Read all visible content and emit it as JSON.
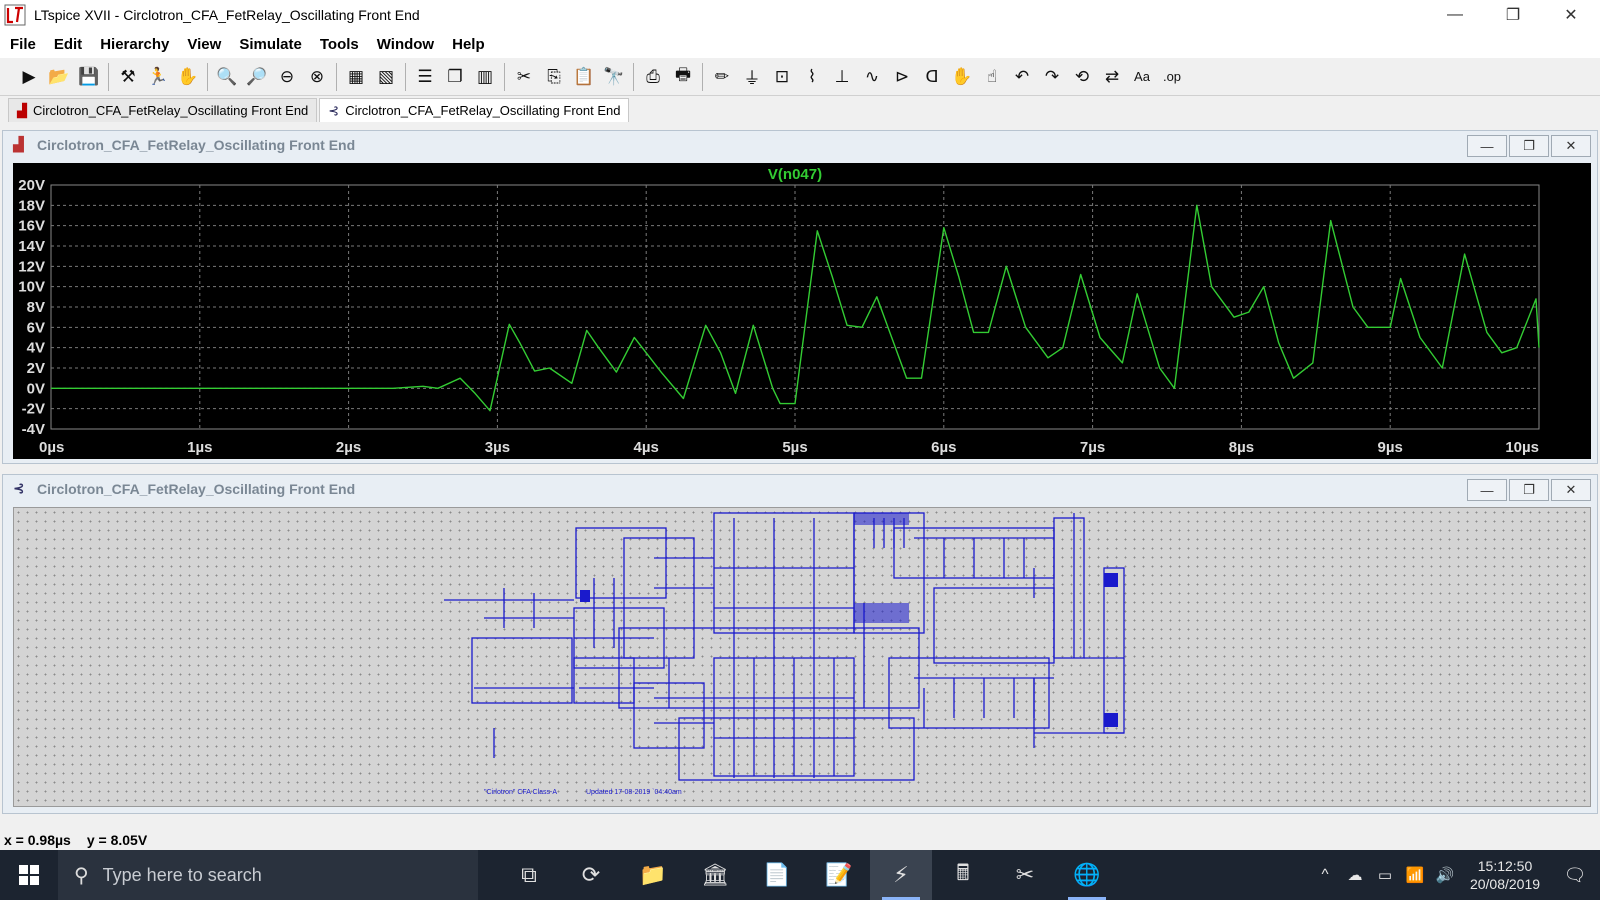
{
  "window": {
    "title": "LTspice XVII - Circlotron_CFA_FetRelay_Oscillating Front End"
  },
  "menu": [
    "File",
    "Edit",
    "Hierarchy",
    "View",
    "Simulate",
    "Tools",
    "Window",
    "Help"
  ],
  "toolbar": {
    "buttons": [
      {
        "name": "run-icon",
        "glyph": "▶"
      },
      {
        "name": "open-icon",
        "glyph": "📂"
      },
      {
        "name": "save-icon",
        "glyph": "💾"
      },
      {
        "sep": true
      },
      {
        "name": "control-panel-icon",
        "glyph": "⚒"
      },
      {
        "name": "run-sim-icon",
        "glyph": "🏃"
      },
      {
        "name": "halt-icon",
        "glyph": "✋"
      },
      {
        "sep": true
      },
      {
        "name": "zoom-in-icon",
        "glyph": "🔍"
      },
      {
        "name": "zoom-pan-icon",
        "glyph": "🔎"
      },
      {
        "name": "zoom-out-icon",
        "glyph": "⊖"
      },
      {
        "name": "zoom-fit-icon",
        "glyph": "⊗"
      },
      {
        "sep": true
      },
      {
        "name": "autorange-icon",
        "glyph": "▦"
      },
      {
        "name": "delete-trace-icon",
        "glyph": "▧"
      },
      {
        "sep": true
      },
      {
        "name": "tile-horizontal-icon",
        "glyph": "☰"
      },
      {
        "name": "cascade-icon",
        "glyph": "❐"
      },
      {
        "name": "tile-vertical-icon",
        "glyph": "▥"
      },
      {
        "sep": true
      },
      {
        "name": "cut-icon",
        "glyph": "✂"
      },
      {
        "name": "copy-icon",
        "glyph": "⎘"
      },
      {
        "name": "paste-icon",
        "glyph": "📋"
      },
      {
        "name": "find-icon",
        "glyph": "🔭"
      },
      {
        "sep": true
      },
      {
        "name": "print-icon",
        "glyph": "⎙"
      },
      {
        "name": "print-setup-icon",
        "glyph": "🖶"
      },
      {
        "sep": true
      },
      {
        "name": "wire-icon",
        "glyph": "✏"
      },
      {
        "name": "ground-icon",
        "glyph": "⏚"
      },
      {
        "name": "label-net-icon",
        "glyph": "⊡"
      },
      {
        "name": "resistor-icon",
        "glyph": "⌇"
      },
      {
        "name": "capacitor-icon",
        "glyph": "⊥"
      },
      {
        "name": "inductor-icon",
        "glyph": "∿"
      },
      {
        "name": "diode-icon",
        "glyph": "⊳"
      },
      {
        "name": "component-icon",
        "glyph": "ᗡ"
      },
      {
        "name": "move-icon",
        "glyph": "✋"
      },
      {
        "name": "drag-icon",
        "glyph": "☝"
      },
      {
        "name": "undo-icon",
        "glyph": "↶"
      },
      {
        "name": "redo-icon",
        "glyph": "↷"
      },
      {
        "name": "rotate-icon",
        "glyph": "⟲"
      },
      {
        "name": "mirror-icon",
        "glyph": "⇄"
      },
      {
        "name": "text-icon",
        "glyph": "Aa"
      },
      {
        "name": "spice-directive-icon",
        "glyph": ".op"
      }
    ]
  },
  "tabs": [
    {
      "label": "Circlotron_CFA_FetRelay_Oscillating Front End",
      "icon": "waveform-icon",
      "active": false
    },
    {
      "label": "Circlotron_CFA_FetRelay_Oscillating Front End",
      "icon": "schematic-icon",
      "active": true
    }
  ],
  "plot_window": {
    "title": "Circlotron_CFA_FetRelay_Oscillating Front End",
    "minimize": "—",
    "restore": "❐",
    "close": "✕"
  },
  "schematic_window": {
    "title": "Circlotron_CFA_FetRelay_Oscillating Front End",
    "minimize": "—",
    "restore": "❐",
    "close": "✕",
    "caption_left": "\"Cirlotron\" CFA Class-A",
    "caption_right": "Updated 17-08-2019  `04:40am"
  },
  "chart_data": {
    "type": "line",
    "title": "V(n047)",
    "xlabel": "",
    "ylabel": "",
    "xlim": [
      0,
      10
    ],
    "ylim": [
      -4,
      20
    ],
    "x_ticks": [
      "0µs",
      "1µs",
      "2µs",
      "3µs",
      "4µs",
      "5µs",
      "6µs",
      "7µs",
      "8µs",
      "9µs",
      "10µs"
    ],
    "y_ticks": [
      "20V",
      "18V",
      "16V",
      "14V",
      "12V",
      "10V",
      "8V",
      "6V",
      "4V",
      "2V",
      "0V",
      "-2V",
      "-4V"
    ],
    "grid": true,
    "trace_color": "#33cc33",
    "series": [
      {
        "name": "V(n047)",
        "x": [
          0,
          1,
          2,
          2.3,
          2.5,
          2.6,
          2.75,
          2.85,
          2.95,
          3.08,
          3.15,
          3.25,
          3.35,
          3.5,
          3.6,
          3.68,
          3.8,
          3.92,
          4.0,
          4.1,
          4.25,
          4.4,
          4.5,
          4.6,
          4.72,
          4.85,
          4.9,
          5.0,
          5.15,
          5.25,
          5.35,
          5.45,
          5.55,
          5.65,
          5.75,
          5.85,
          6.0,
          6.1,
          6.2,
          6.3,
          6.42,
          6.55,
          6.7,
          6.8,
          6.92,
          7.05,
          7.2,
          7.3,
          7.45,
          7.55,
          7.7,
          7.8,
          7.95,
          8.05,
          8.15,
          8.25,
          8.35,
          8.48,
          8.6,
          8.75,
          8.85,
          9.0,
          9.07,
          9.2,
          9.35,
          9.5,
          9.65,
          9.75,
          9.85,
          9.98,
          10
        ],
        "y": [
          0,
          0,
          0,
          0,
          0.2,
          0,
          1.0,
          -0.5,
          -2.2,
          6.3,
          4.5,
          1.7,
          2.0,
          0.5,
          5.7,
          4.0,
          1.6,
          5.0,
          3.5,
          1.6,
          -1.0,
          6.2,
          3.5,
          -0.5,
          6.2,
          0,
          -1.5,
          -1.5,
          15.5,
          11.0,
          6.2,
          6.0,
          9.0,
          5.0,
          1.0,
          1.0,
          15.8,
          11.0,
          5.5,
          5.5,
          12.0,
          6.0,
          3.0,
          4.0,
          11.2,
          5.0,
          2.5,
          9.3,
          2.0,
          0.0,
          18.0,
          10.0,
          7.0,
          7.5,
          10.0,
          4.5,
          1.0,
          2.5,
          16.5,
          8.0,
          6.0,
          6.0,
          10.8,
          5.0,
          2.0,
          13.2,
          5.5,
          3.5,
          4.0,
          8.8,
          4.0
        ]
      }
    ]
  },
  "status": {
    "x": "x = 0.98µs",
    "y": "y = 8.05V"
  },
  "taskbar": {
    "search_placeholder": "Type here to search",
    "apps": [
      {
        "name": "task-view-icon",
        "glyph": "⧉"
      },
      {
        "name": "sync-app-icon",
        "glyph": "⟳"
      },
      {
        "name": "file-explorer-icon",
        "glyph": "📁"
      },
      {
        "name": "library-icon",
        "glyph": "🏛"
      },
      {
        "name": "document-icon",
        "glyph": "📄"
      },
      {
        "name": "notes-icon",
        "glyph": "📝"
      },
      {
        "name": "ltspice-icon",
        "glyph": "⚡"
      },
      {
        "name": "calculator-icon",
        "glyph": "🖩"
      },
      {
        "name": "snipping-tool-icon",
        "glyph": "✂"
      },
      {
        "name": "browser-icon",
        "glyph": "🌐"
      }
    ],
    "tray": [
      "^",
      "☁",
      "▭",
      "📶",
      "🔊"
    ],
    "time": "15:12:50",
    "date": "20/08/2019",
    "notification_glyph": "🗨"
  }
}
